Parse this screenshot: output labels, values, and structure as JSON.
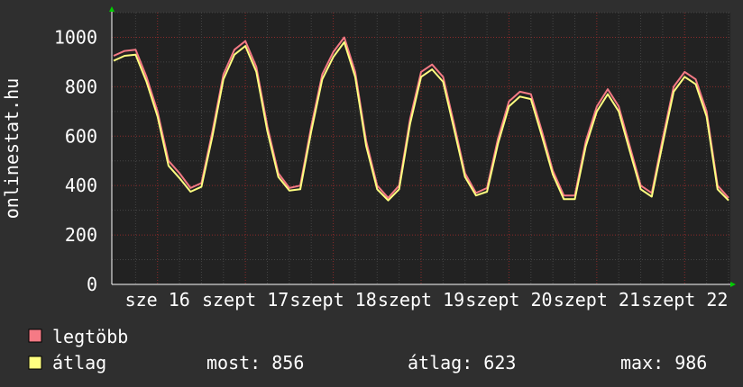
{
  "chart_data": {
    "type": "line",
    "ylabel": "onlinestat.hu",
    "ylim": [
      0,
      1100
    ],
    "y_ticks": [
      "0",
      "200",
      "400",
      "600",
      "800",
      "1000"
    ],
    "x_tick_labels": [
      "sze 16",
      "szept 17",
      "szept 18",
      "szept 19",
      "szept 20",
      "szept 21",
      "szept 22",
      "sze"
    ],
    "grid": true,
    "legend_placement": "bottom-left",
    "background": "#222222",
    "outer_background": "#2f2f2f",
    "series": [
      {
        "name": "legtöbb",
        "color": "#f57a85",
        "x": [
          0,
          0.25,
          0.5,
          0.75,
          1,
          1.25,
          1.5,
          1.75,
          2,
          2.25,
          2.5,
          2.75,
          3,
          3.25,
          3.5,
          3.75,
          4,
          4.25,
          4.5,
          4.75,
          5,
          5.25,
          5.5,
          5.75,
          6,
          6.25,
          6.5,
          6.75,
          7,
          7.25,
          7.5,
          7.75,
          8,
          8.25,
          8.5,
          8.75,
          9,
          9.25,
          9.5,
          9.75,
          10,
          10.25,
          10.5,
          10.75,
          11,
          11.25,
          11.5,
          11.75,
          12,
          12.25,
          12.5,
          12.75,
          13,
          13.25,
          13.5,
          13.75,
          14
        ],
        "y": [
          925,
          945,
          950,
          840,
          700,
          500,
          450,
          390,
          410,
          620,
          850,
          950,
          985,
          880,
          640,
          450,
          390,
          400,
          640,
          850,
          940,
          1000,
          860,
          580,
          400,
          350,
          400,
          670,
          860,
          890,
          840,
          650,
          450,
          370,
          390,
          590,
          740,
          780,
          770,
          620,
          460,
          360,
          360,
          580,
          720,
          790,
          720,
          560,
          400,
          370,
          590,
          800,
          860,
          830,
          700,
          400,
          350
        ]
      },
      {
        "name": "átlag",
        "color": "#ffff80",
        "x": [
          0,
          0.25,
          0.5,
          0.75,
          1,
          1.25,
          1.5,
          1.75,
          2,
          2.25,
          2.5,
          2.75,
          3,
          3.25,
          3.5,
          3.75,
          4,
          4.25,
          4.5,
          4.75,
          5,
          5.25,
          5.5,
          5.75,
          6,
          6.25,
          6.5,
          6.75,
          7,
          7.25,
          7.5,
          7.75,
          8,
          8.25,
          8.5,
          8.75,
          9,
          9.25,
          9.5,
          9.75,
          10,
          10.25,
          10.5,
          10.75,
          11,
          11.25,
          11.5,
          11.75,
          12,
          12.25,
          12.5,
          12.75,
          13,
          13.25,
          13.5,
          13.75,
          14
        ],
        "y": [
          905,
          925,
          930,
          820,
          680,
          480,
          430,
          375,
          395,
          600,
          830,
          930,
          965,
          860,
          620,
          435,
          380,
          385,
          620,
          830,
          920,
          980,
          840,
          560,
          385,
          340,
          385,
          650,
          840,
          870,
          820,
          630,
          435,
          360,
          375,
          570,
          720,
          760,
          750,
          600,
          445,
          345,
          345,
          560,
          700,
          770,
          700,
          540,
          385,
          355,
          570,
          780,
          840,
          810,
          680,
          385,
          340
        ]
      }
    ]
  },
  "legend": {
    "items": [
      {
        "label": "legtöbb",
        "color": "#f57a85"
      },
      {
        "label": "átlag",
        "color": "#ffff80"
      }
    ]
  },
  "stats": {
    "most": "most: 856",
    "atlag": "átlag: 623",
    "max": "max: 986"
  }
}
